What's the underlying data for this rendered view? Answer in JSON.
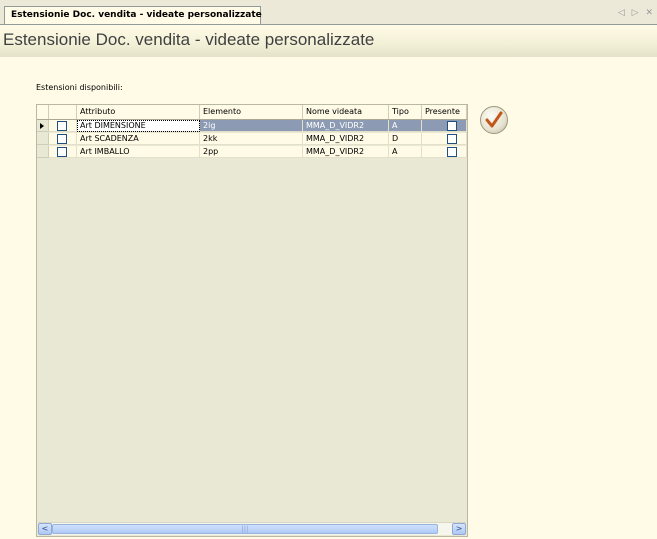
{
  "tab": {
    "label": "Estensionie Doc. vendita - videate personalizzate",
    "nav": "◁ ▷ ✕"
  },
  "page": {
    "title": "Estensionie Doc. vendita - videate personalizzate"
  },
  "section": {
    "label": "Estensioni disponibili:"
  },
  "grid": {
    "columns": [
      "",
      "Attributo",
      "Elemento",
      "Nome videata",
      "Tipo",
      "Presente"
    ],
    "rows": [
      {
        "check": false,
        "attributo": "Art DIMENSIONE",
        "elemento": "2ig",
        "nome_videata": "MMA_D_VIDR2",
        "tipo": "A",
        "presente": false,
        "selected": true
      },
      {
        "check": false,
        "attributo": "Art  SCADENZA",
        "elemento": "2kk",
        "nome_videata": "MMA_D_VIDR2",
        "tipo": "D",
        "presente": false,
        "selected": false
      },
      {
        "check": false,
        "attributo": "Art IMBALLO",
        "elemento": "2pp",
        "nome_videata": "MMA_D_VIDR2",
        "tipo": "A",
        "presente": false,
        "selected": false
      }
    ]
  },
  "scrollbar": {
    "left_arrow": "<",
    "right_arrow": ">",
    "thumb_grip": "|||"
  },
  "colors": {
    "background": "#fffbe6",
    "selection": "#8c9ab4",
    "confirm_mark": "#c2571a"
  },
  "icons": {
    "confirm": "checkmark-icon",
    "row_pointer": "row-pointer-arrow-icon"
  }
}
